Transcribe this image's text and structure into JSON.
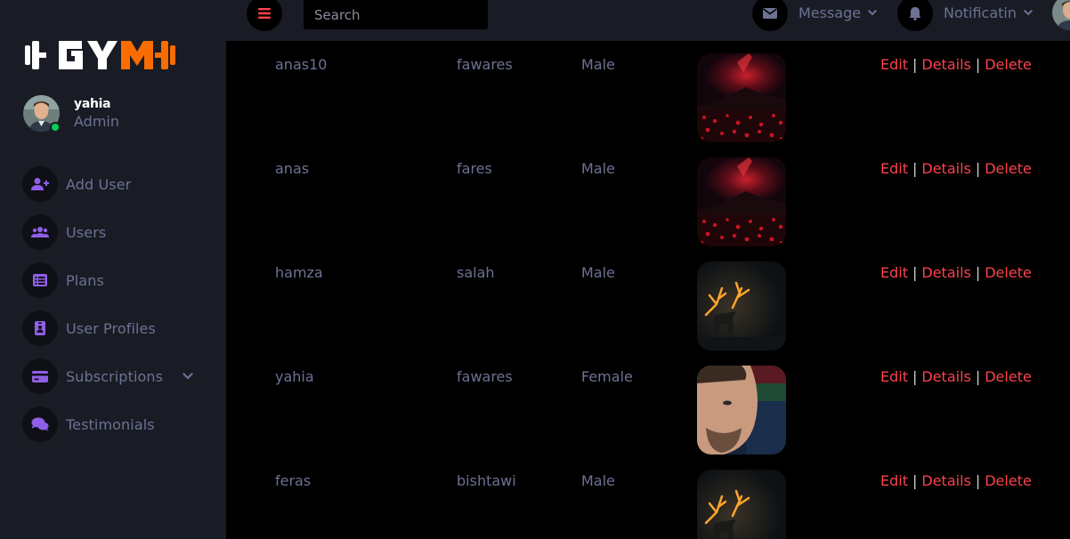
{
  "brand": {
    "logo_text": "GYM",
    "accent": "#f96d00"
  },
  "profile": {
    "name": "yahia",
    "role": "Admin",
    "status": "online"
  },
  "sidebar": {
    "items": [
      {
        "label": "Add User",
        "icon": "user-plus-icon"
      },
      {
        "label": "Users",
        "icon": "users-icon"
      },
      {
        "label": "Plans",
        "icon": "list-icon"
      },
      {
        "label": "User Profiles",
        "icon": "id-badge-icon"
      },
      {
        "label": "Subscriptions",
        "icon": "credit-card-icon",
        "expandable": true
      },
      {
        "label": "Testimonials",
        "icon": "comments-icon"
      }
    ]
  },
  "topbar": {
    "search_placeholder": "Search",
    "message_label": "Message",
    "notification_label": "Notificatin"
  },
  "table": {
    "rows": [
      {
        "username": "anas10",
        "last_name": "fawares",
        "gender": "Male",
        "image": "red-nebula-mountain"
      },
      {
        "username": "anas",
        "last_name": "fares",
        "gender": "Male",
        "image": "red-nebula-mountain"
      },
      {
        "username": "hamza",
        "last_name": "salah",
        "gender": "Male",
        "image": "glowing-deer"
      },
      {
        "username": "yahia",
        "last_name": "fawares",
        "gender": "Female",
        "image": "man-portrait"
      },
      {
        "username": "feras",
        "last_name": "bishtawi",
        "gender": "Male",
        "image": "glowing-deer"
      }
    ],
    "actions": {
      "edit": "Edit",
      "details": "Details",
      "delete": "Delete",
      "separator": "|"
    }
  },
  "colors": {
    "sidebar_bg": "#191c24",
    "page_bg": "#000000",
    "muted_text": "#6c7293",
    "danger": "#fc424a",
    "success": "#00d25b"
  }
}
